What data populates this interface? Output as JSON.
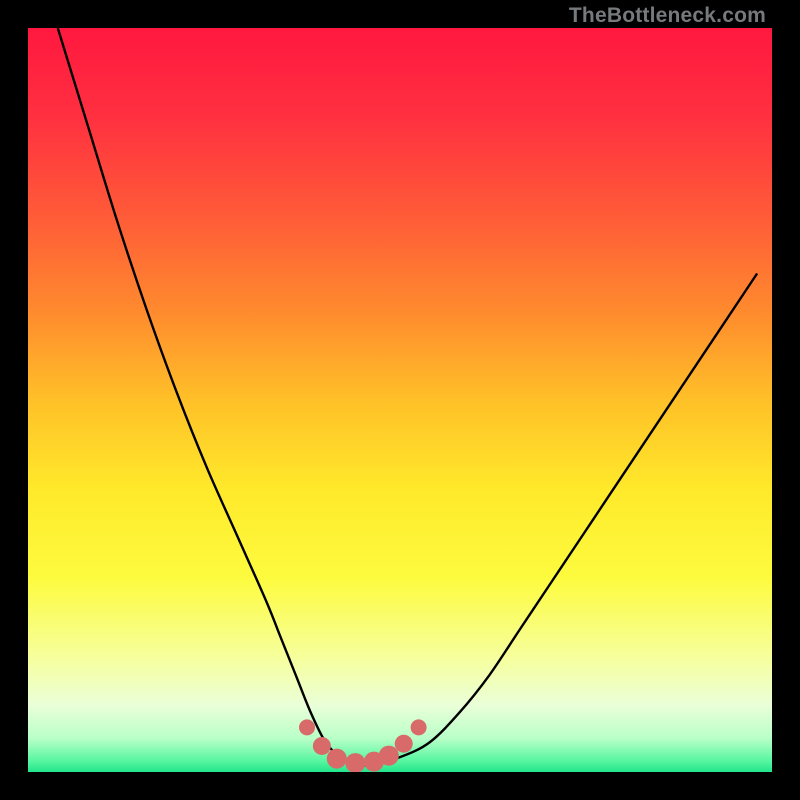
{
  "watermark": "TheBottleneck.com",
  "colors": {
    "frame": "#000000",
    "marker": "#d86a6a",
    "curve": "#000000",
    "gradient_stops": [
      {
        "pos": 0.0,
        "color": "#ff183f"
      },
      {
        "pos": 0.12,
        "color": "#ff3040"
      },
      {
        "pos": 0.25,
        "color": "#ff5a38"
      },
      {
        "pos": 0.38,
        "color": "#ff8a2e"
      },
      {
        "pos": 0.5,
        "color": "#ffc028"
      },
      {
        "pos": 0.62,
        "color": "#ffe92a"
      },
      {
        "pos": 0.74,
        "color": "#fdfb3f"
      },
      {
        "pos": 0.85,
        "color": "#f6ffa0"
      },
      {
        "pos": 0.91,
        "color": "#eaffd8"
      },
      {
        "pos": 0.955,
        "color": "#b8ffc8"
      },
      {
        "pos": 0.985,
        "color": "#58f6a0"
      },
      {
        "pos": 1.0,
        "color": "#22e58c"
      }
    ]
  },
  "chart_data": {
    "type": "line",
    "title": "",
    "xlabel": "",
    "ylabel": "",
    "xlim": [
      0,
      100
    ],
    "ylim": [
      0,
      100
    ],
    "series": [
      {
        "name": "bottleneck-curve",
        "x": [
          4,
          8,
          12,
          16,
          20,
          24,
          28,
          32,
          34,
          36,
          38,
          40,
          42,
          44,
          46,
          50,
          54,
          58,
          62,
          66,
          70,
          74,
          78,
          82,
          86,
          90,
          94,
          98
        ],
        "y": [
          100,
          87,
          74,
          62,
          51,
          41,
          32,
          23,
          18,
          13,
          8,
          4,
          2,
          1,
          1,
          2,
          4,
          8,
          13,
          19,
          25,
          31,
          37,
          43,
          49,
          55,
          61,
          67
        ]
      }
    ],
    "markers": {
      "name": "optimal-range",
      "x": [
        37.5,
        39.5,
        41.5,
        44.0,
        46.5,
        48.5,
        50.5,
        52.5
      ],
      "y": [
        6.0,
        3.5,
        1.8,
        1.2,
        1.4,
        2.2,
        3.8,
        6.0
      ],
      "r": [
        8,
        9,
        10,
        10,
        10,
        10,
        9,
        8
      ]
    }
  }
}
